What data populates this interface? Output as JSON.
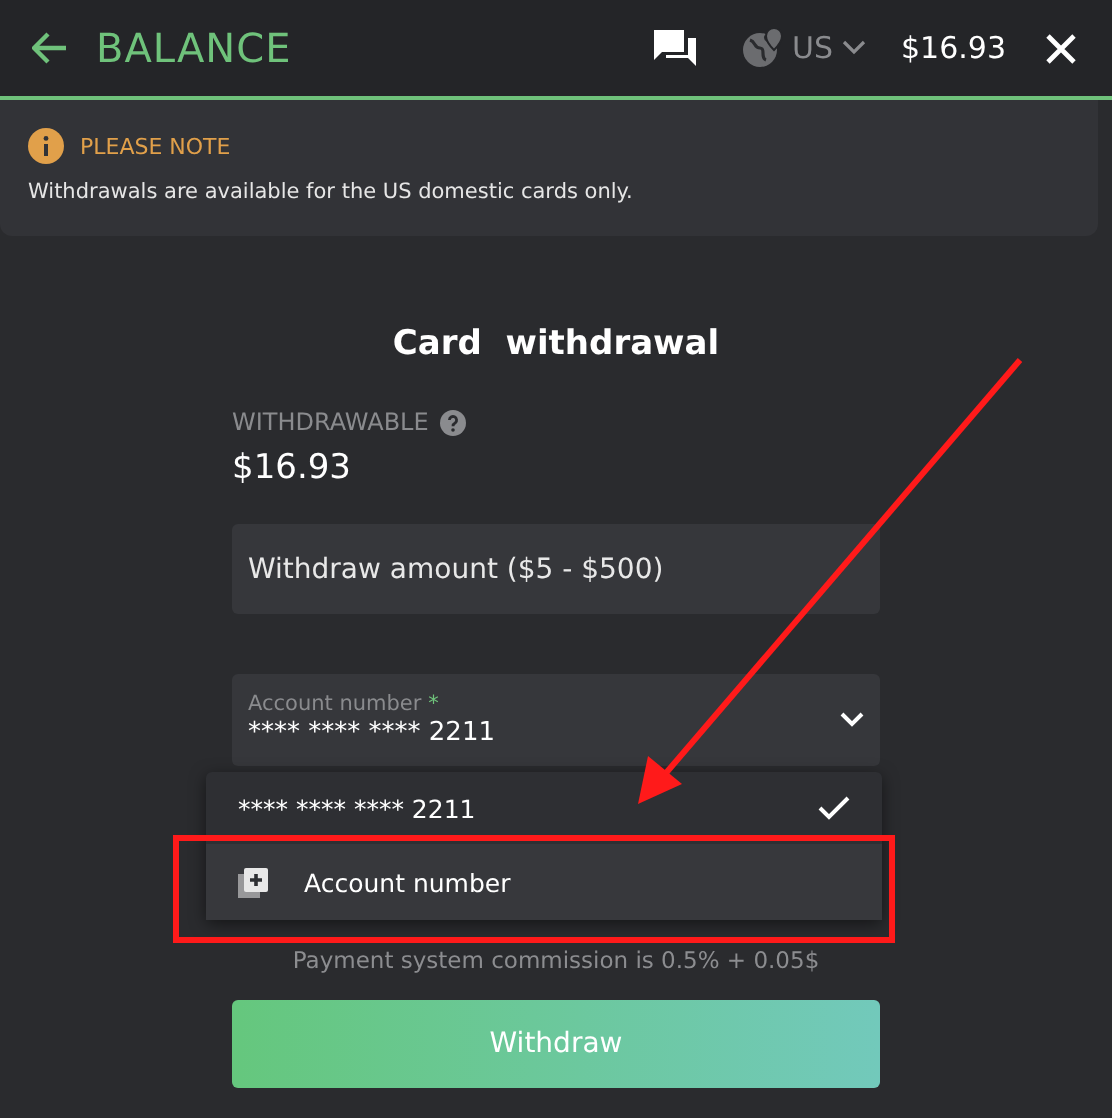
{
  "header": {
    "title": "BALANCE",
    "region": "US",
    "balance": "$16.93"
  },
  "note": {
    "heading": "PLEASE NOTE",
    "text": "Withdrawals are available for the US domestic cards only."
  },
  "form": {
    "title": "Card  withdrawal",
    "withdrawable_label": "WITHDRAWABLE",
    "withdrawable_amount": "$16.93",
    "amount_field": {
      "placeholder": "Withdraw amount ($5 - $500)"
    },
    "account_select": {
      "label": "Account number",
      "required_mark": "*",
      "value": "**** **** **** 2211",
      "expanded": true
    },
    "options": [
      {
        "kind": "account",
        "label": "**** **** **** 2211",
        "selected": true
      },
      {
        "kind": "add",
        "label": "Account number",
        "selected": false
      }
    ],
    "commission": "Payment system commission is 0.5% + 0.05$",
    "button": "Withdraw"
  }
}
